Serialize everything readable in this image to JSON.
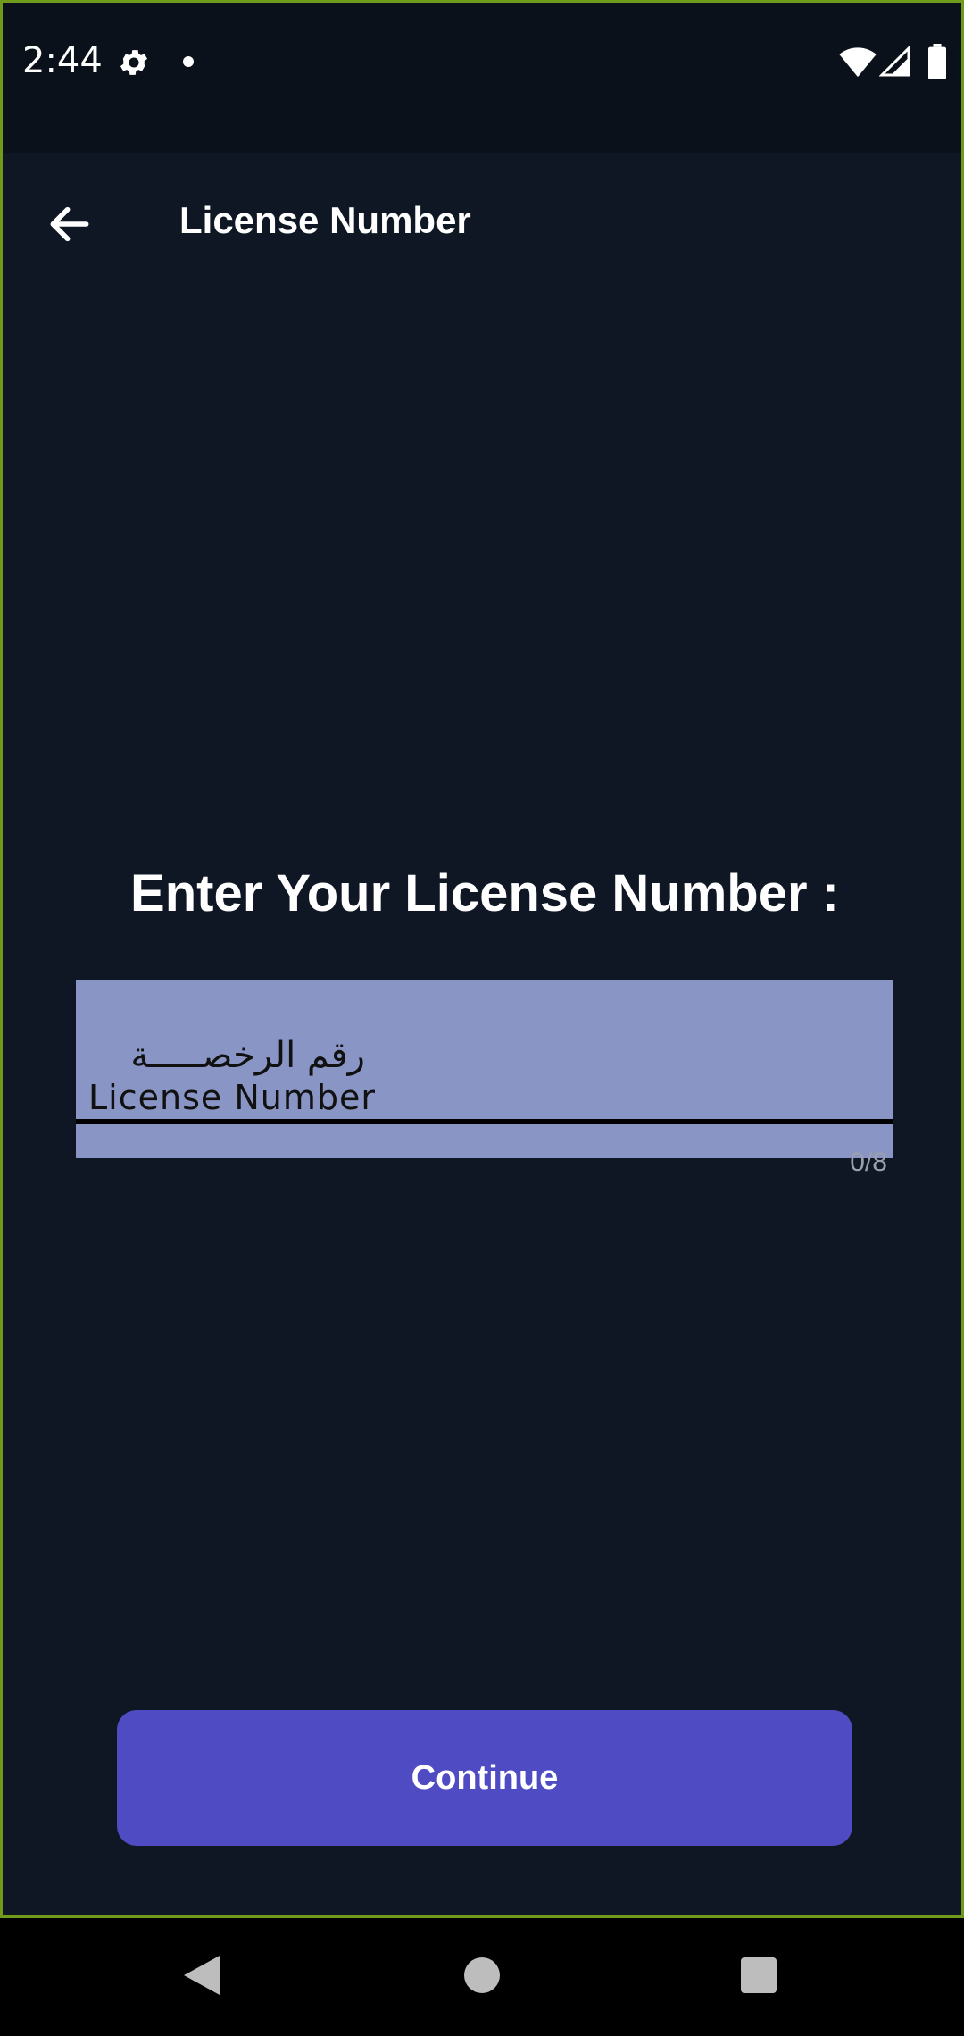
{
  "status_bar": {
    "time": "2:44",
    "icons": [
      "gear-icon",
      "notification-dot-icon",
      "wifi-icon",
      "signal-icon",
      "battery-icon"
    ]
  },
  "app_bar": {
    "back_icon": "arrow-back-icon",
    "title": "License Number"
  },
  "main": {
    "heading": "Enter Your License Number :",
    "license_field": {
      "value": "",
      "label_arabic": "رقم الرخصـــــة",
      "label_english": "License Number",
      "counter": "0/8"
    },
    "continue_label": "Continue"
  },
  "nav_bar": {
    "icons": [
      "nav-back-icon",
      "nav-home-icon",
      "nav-recents-icon"
    ]
  },
  "colors": {
    "background": "#0f1724",
    "status_bar": "#0b111b",
    "field_fill": "#8995c4",
    "button": "#4f4bc2",
    "frame_border": "#6f9a1a"
  }
}
